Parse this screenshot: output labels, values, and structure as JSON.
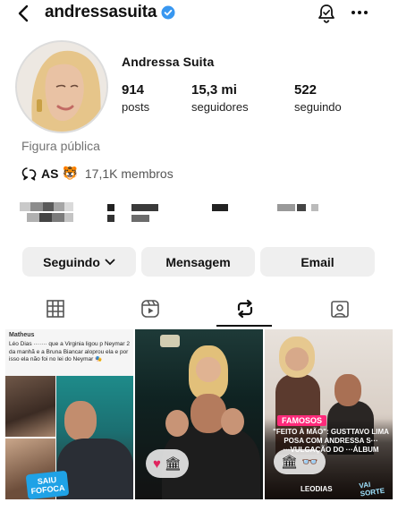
{
  "header": {
    "username": "andressasuita",
    "verified_icon": "verified-badge-icon",
    "back_icon": "back-arrow-icon",
    "notifications_icon": "bell-icon",
    "more_icon": "more-dots-icon"
  },
  "profile": {
    "display_name": "Andressa Suita",
    "category": "Figura pública",
    "stats": {
      "posts": {
        "value": "914",
        "label": "posts"
      },
      "followers": {
        "value": "15,3 mi",
        "label": "seguidores"
      },
      "following": {
        "value": "522",
        "label": "seguindo"
      }
    },
    "community": {
      "name": "AS",
      "emoji": "🐯",
      "members": "17,1K membros"
    }
  },
  "actions": {
    "follow": "Seguindo",
    "message": "Mensagem",
    "email": "Email"
  },
  "tabs": [
    "grid-icon",
    "reels-icon",
    "reposts-icon",
    "tagged-icon"
  ],
  "active_tab": "reposts",
  "posts": {
    "p1": {
      "author": "Matheus",
      "snippet": "Léo Dias ······· que a Virginia ligou p Neymar 2 da manhã e a Bruna Biancar aloprou ela e por isso ela não foi no lei do Neymar 🎭",
      "logo_line1": "SAIU",
      "logo_line2": "FOFOCA"
    },
    "p2": {
      "reaction1": "♥",
      "reaction2": "🏛"
    },
    "p3": {
      "tag": "FAMOSOS",
      "headline": "\"FEITO À MÃO\": GUSTTAVO LIMA POSA COM ANDRESSA S··· ···VULGAÇÃO DO ···ÁLBUM",
      "source": "LEODIAS",
      "brand": "VAI SORTE"
    }
  },
  "colors": {
    "button_bg": "#efefef",
    "verified": "#3897f0",
    "tag_pink": "#ff2a7a"
  }
}
